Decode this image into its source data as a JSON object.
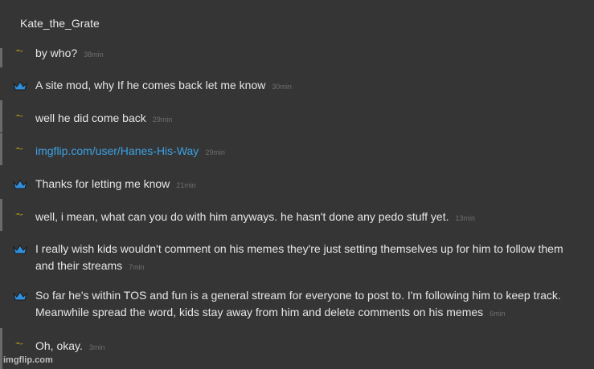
{
  "chat": {
    "title": "Kate_the_Grate",
    "messages": [
      {
        "author_icon": "spark-icon",
        "text": "by who?",
        "time": "38min",
        "link": false
      },
      {
        "author_icon": "crown-icon",
        "text": "A site mod, why If he comes back let me know",
        "time": "30min",
        "link": false
      },
      {
        "author_icon": "spark-icon",
        "text": "well he did come back",
        "time": "29min",
        "link": false
      },
      {
        "author_icon": "spark-icon",
        "text": "imgflip.com/user/Hanes-His-Way",
        "time": "29min",
        "link": true
      },
      {
        "author_icon": "crown-icon",
        "text": "Thanks for letting me know",
        "time": "21min",
        "link": false
      },
      {
        "author_icon": "spark-icon",
        "text": "well, i mean, what can you do with him anyways. he hasn't done any pedo stuff yet.",
        "time": "13min",
        "link": false
      },
      {
        "author_icon": "crown-icon",
        "text": "I really wish kids wouldn't comment on his memes they're just setting themselves up for him to follow them and their streams",
        "time": "7min",
        "link": false
      },
      {
        "author_icon": "crown-icon",
        "text": "So far he's within TOS and fun is a general stream for everyone to post to. I'm following him to keep track. Meanwhile spread the word, kids stay away from him and delete comments on his memes",
        "time": "6min",
        "link": false
      },
      {
        "author_icon": "spark-icon",
        "text": "Oh, okay.",
        "time": "3min",
        "link": false
      }
    ]
  },
  "watermark": "imgflip.com",
  "colors": {
    "background": "#353535",
    "link": "#3ba3e6",
    "crown": "#2f8fdc",
    "spark": "#f2c200"
  }
}
